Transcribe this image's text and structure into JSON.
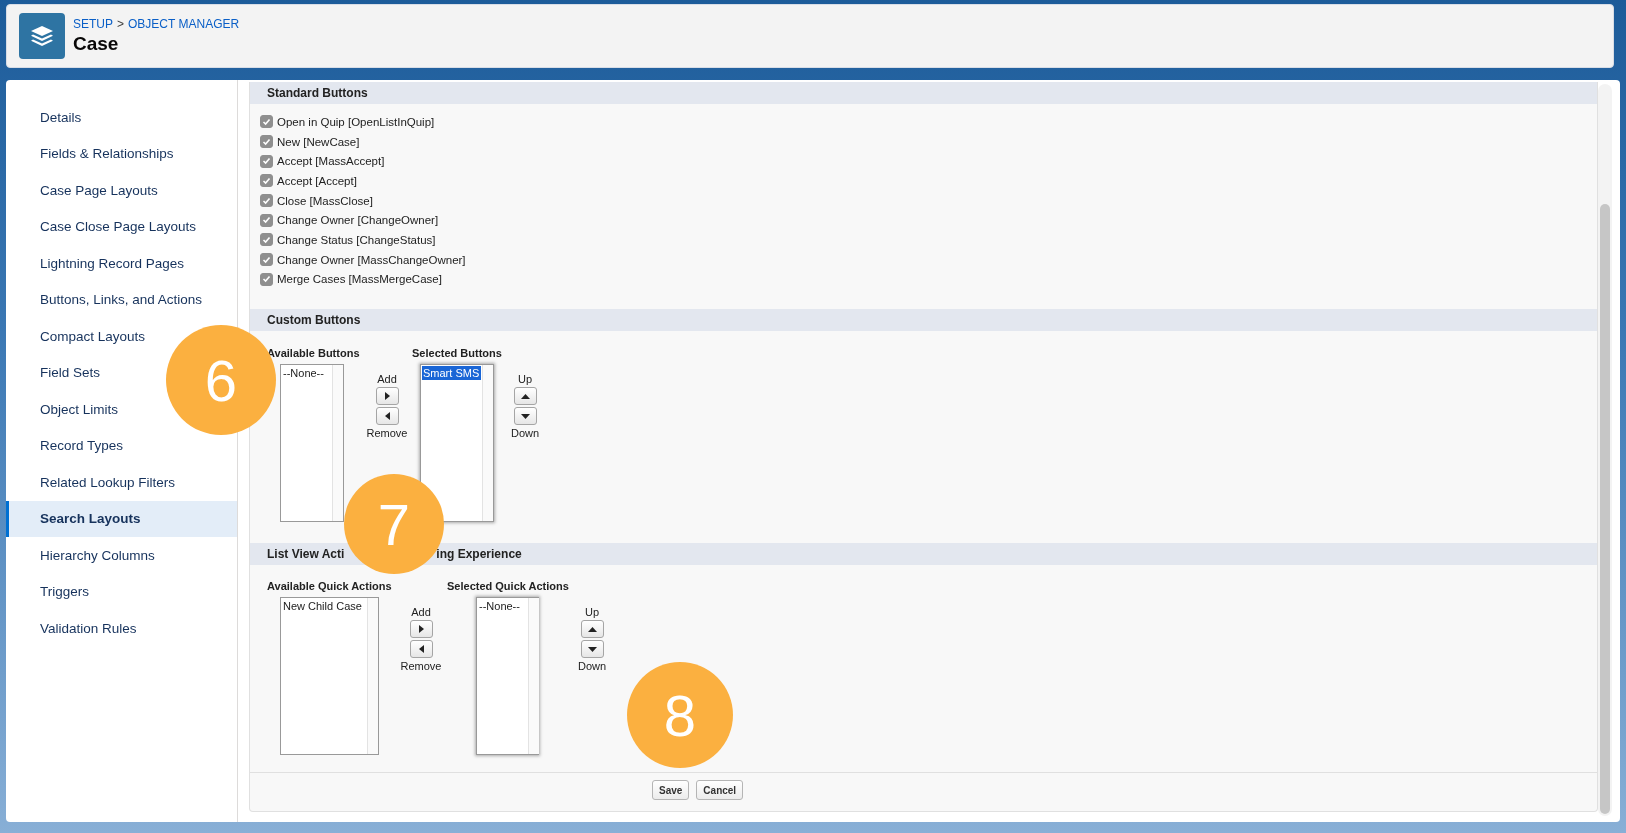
{
  "header": {
    "breadcrumb": [
      {
        "text": "SETUP",
        "kind": "link"
      },
      {
        "text": ">",
        "kind": "separator"
      },
      {
        "text": "OBJECT MANAGER",
        "kind": "link"
      }
    ],
    "title": "Case"
  },
  "sidebar": {
    "items": [
      {
        "label": "Details",
        "selected": false
      },
      {
        "label": "Fields & Relationships",
        "selected": false
      },
      {
        "label": "Case Page Layouts",
        "selected": false
      },
      {
        "label": "Case Close Page Layouts",
        "selected": false
      },
      {
        "label": "Lightning Record Pages",
        "selected": false
      },
      {
        "label": "Buttons, Links, and Actions",
        "selected": false
      },
      {
        "label": "Compact Layouts",
        "selected": false
      },
      {
        "label": "Field Sets",
        "selected": false
      },
      {
        "label": "Object Limits",
        "selected": false
      },
      {
        "label": "Record Types",
        "selected": false
      },
      {
        "label": "Related Lookup Filters",
        "selected": false
      },
      {
        "label": "Search Layouts",
        "selected": true
      },
      {
        "label": "Hierarchy Columns",
        "selected": false
      },
      {
        "label": "Triggers",
        "selected": false
      },
      {
        "label": "Validation Rules",
        "selected": false
      }
    ]
  },
  "standard_buttons": {
    "title": "Standard Buttons",
    "items": [
      {
        "label": "Open in Quip [OpenListInQuip]",
        "checked": true
      },
      {
        "label": "New [NewCase]",
        "checked": true
      },
      {
        "label": "Accept [MassAccept]",
        "checked": true
      },
      {
        "label": "Accept [Accept]",
        "checked": true
      },
      {
        "label": "Close [MassClose]",
        "checked": true
      },
      {
        "label": "Change Owner [ChangeOwner]",
        "checked": true
      },
      {
        "label": "Change Status [ChangeStatus]",
        "checked": true
      },
      {
        "label": "Change Owner [MassChangeOwner]",
        "checked": true
      },
      {
        "label": "Merge Cases [MassMergeCase]",
        "checked": true
      }
    ]
  },
  "custom_buttons": {
    "title": [
      "Custom Buttons"
    ],
    "available": {
      "label": "Available Buttons",
      "options": [
        {
          "text": "--None--",
          "selected": false
        }
      ]
    },
    "add_label": "Add",
    "remove_label": "Remove",
    "selected": {
      "label": "Selected Buttons",
      "options": [
        {
          "text": "Smart SMS",
          "selected": true
        }
      ]
    },
    "up_label": "Up",
    "down_label": "Down"
  },
  "list_view_actions": {
    "title": [
      "List View Acti",
      "ing Experience"
    ],
    "available": {
      "label": "Available Quick Actions",
      "options": [
        {
          "text": "New Child Case",
          "selected": false
        }
      ]
    },
    "add_label": "Add",
    "remove_label": "Remove",
    "selected": {
      "label": "Selected Quick Actions",
      "options": [
        {
          "text": "--None--",
          "selected": false
        }
      ]
    },
    "up_label": "Up",
    "down_label": "Down"
  },
  "footer_buttons": [
    "Save",
    "Cancel"
  ],
  "callouts": [
    "6",
    "7",
    "8"
  ]
}
